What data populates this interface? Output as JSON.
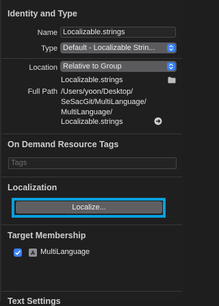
{
  "identity": {
    "title": "Identity and Type",
    "name_label": "Name",
    "name_value": "Localizable.strings",
    "type_label": "Type",
    "type_value": "Default - Localizable Strin...",
    "location_label": "Location",
    "location_value": "Relative to Group",
    "location_file": "Localizable.strings",
    "full_path_label": "Full Path",
    "full_path_lines": [
      "/Users/yoon/Desktop/",
      "SeSacGit/MultiLanguage/",
      "MultiLanguage/",
      "Localizable.strings"
    ]
  },
  "on_demand": {
    "title": "On Demand Resource Tags",
    "tags_placeholder": "Tags"
  },
  "localization": {
    "title": "Localization",
    "button_label": "Localize..."
  },
  "target_membership": {
    "title": "Target Membership",
    "target_name": "MultiLanguage",
    "checked": true
  },
  "next_section": {
    "title": "Text Settings"
  },
  "colors": {
    "background": "#1f1f20",
    "accent": "#3a82f6",
    "highlight": "#0aa0dc"
  }
}
